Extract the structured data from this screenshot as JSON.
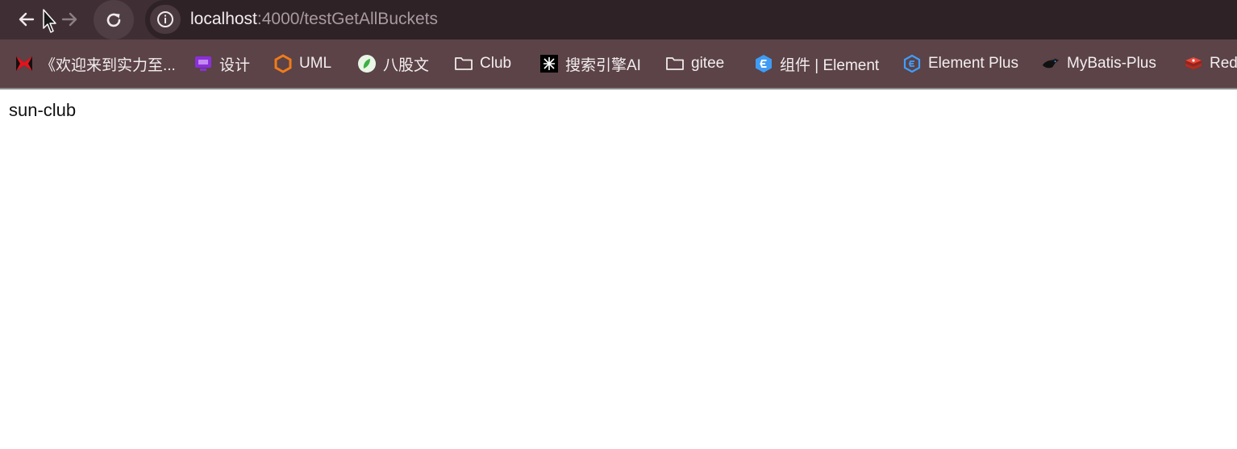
{
  "browser": {
    "url_host": "localhost",
    "url_path": ":4000/testGetAllBuckets",
    "colors": {
      "toolbar": "#3f2f35",
      "bookmarks_bar": "#5b4347",
      "omnibox": "#2f2226"
    }
  },
  "bookmarks": [
    {
      "label": "《欢迎来到实力至...",
      "icon": "red-black-logo-icon"
    },
    {
      "label": "设计",
      "icon": "purple-screen-icon"
    },
    {
      "label": "UML",
      "icon": "orange-hexagon-icon"
    },
    {
      "label": "八股文",
      "icon": "green-circle-icon"
    },
    {
      "label": "Club",
      "icon": "folder-icon"
    },
    {
      "label": "搜索引擎AI",
      "icon": "black-square-logo-icon"
    },
    {
      "label": "gitee",
      "icon": "folder-icon"
    },
    {
      "label": "组件 | Element",
      "icon": "blue-hexagon-icon"
    },
    {
      "label": "Element Plus",
      "icon": "blue-hexagon-outline-icon"
    },
    {
      "label": "MyBatis-Plus",
      "icon": "mybatis-bird-icon"
    },
    {
      "label": "Red",
      "icon": "redis-cube-icon"
    }
  ],
  "page": {
    "text": "sun-club"
  }
}
